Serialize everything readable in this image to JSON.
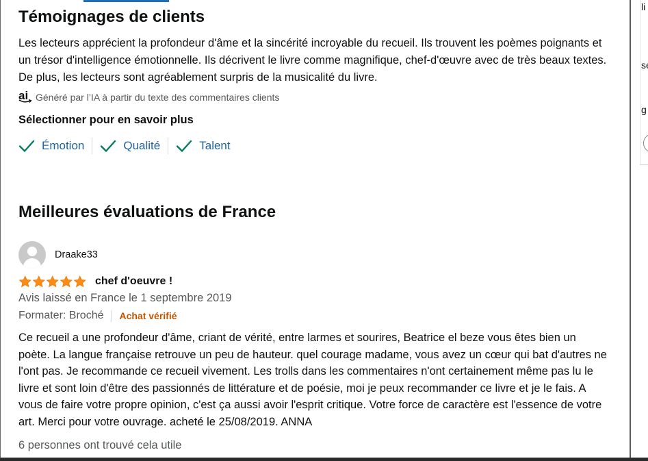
{
  "customer_says": {
    "title": "Témoignages de clients",
    "summary": "Les lecteurs apprécient la profondeur d'âme et la sincérité incroyable du recueil. Ils trouvent les poèmes poignants et un trésor d'intelligence émotionnelle. Ils décrivent le livre comme magnifique, chef-d'œuvre avec de très beaux textes. De plus, les lecteurs sont agréablement surpris de la musicalité du livre.",
    "ai_note": "Généré par l’IA à partir du texte des commentaires clients",
    "ai_icon": "ai-icon",
    "select_label": "Sélectionner pour en savoir plus",
    "aspects": [
      {
        "label": "Émotion",
        "icon": "check-icon"
      },
      {
        "label": "Qualité",
        "icon": "check-icon"
      },
      {
        "label": "Talent",
        "icon": "check-icon"
      }
    ]
  },
  "top_reviews": {
    "title": "Meilleures évaluations de France",
    "review": {
      "reviewer": "Draake33",
      "rating": 5,
      "rating_max": 5,
      "title": "chef d'oeuvre !",
      "date_line": "Avis laissé en France le 1 septembre 2019",
      "format": "Formater: Broché",
      "verified": "Achat vérifié",
      "body": "Ce recueil a une profondeur d'âme, criant de vérité, entre larmes et sourires, Beatrice el beze vous êtes bien un poète. La langue française retrouve un peu de hauteur. quel courage madame, vous avez un cœur qui bat d'autres ne l'ont pas. Je recommande ce recueil vivement. Les trolls dans les commentaires n'ont certainement même pas lu le livre et sont loin d'être des passionnés de littérature et de poésie, moi je peux recommander ce livre et je le fais. A vous de faire votre propre opinion, c'est ça aussi avoir l'esprit critique. Votre force de caractère est l'essence de votre art. Merci pour votre ouvrage. acheté le 25/08/2019. ANNA",
      "helpful": "6 personnes ont trouvé cela utile"
    }
  },
  "right_panel_fragments": [
    "li",
    "se",
    "g"
  ],
  "colors": {
    "link": "#2162a1",
    "check": "#067d62",
    "star": "#ff8c0e",
    "verified": "#c45500",
    "muted": "#565959"
  }
}
